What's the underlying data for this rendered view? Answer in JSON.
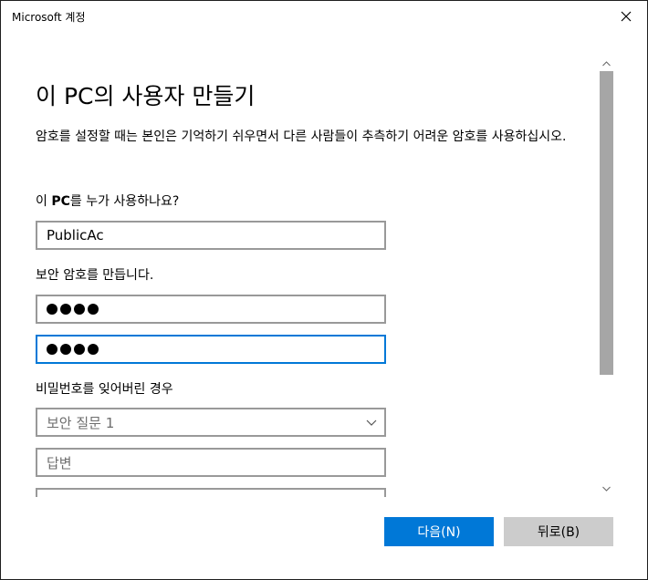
{
  "window": {
    "title": "Microsoft 계정"
  },
  "page": {
    "heading": "이 PC의 사용자 만들기",
    "description": "암호를 설정할 때는 본인은 기억하기 쉬우면서 다른 사람들이 추측하기 어려운 암호를 사용하십시오."
  },
  "form": {
    "username_label_prefix": "이 ",
    "username_label_bold": "PC",
    "username_label_suffix": "를 누가 사용하나요?",
    "username_value": "PublicAc",
    "password_label": "보안 암호를 만듭니다.",
    "password_mask_count": 4,
    "confirm_mask_count": 4,
    "recovery_label": "비밀번호를 잊어버린 경우",
    "security_question_selected": "보안 질문 1",
    "answer_placeholder": "답변"
  },
  "buttons": {
    "next": "다음(N)",
    "back": "뒤로(B)"
  },
  "colors": {
    "accent": "#0078d7",
    "field_border": "#999999",
    "secondary_button": "#cccccc",
    "scroll_thumb": "#a6a6a6"
  },
  "icons": {
    "close": "close-icon",
    "dropdown": "chevron-down-icon",
    "scroll_up": "chevron-up-icon",
    "scroll_down": "chevron-down-icon"
  }
}
